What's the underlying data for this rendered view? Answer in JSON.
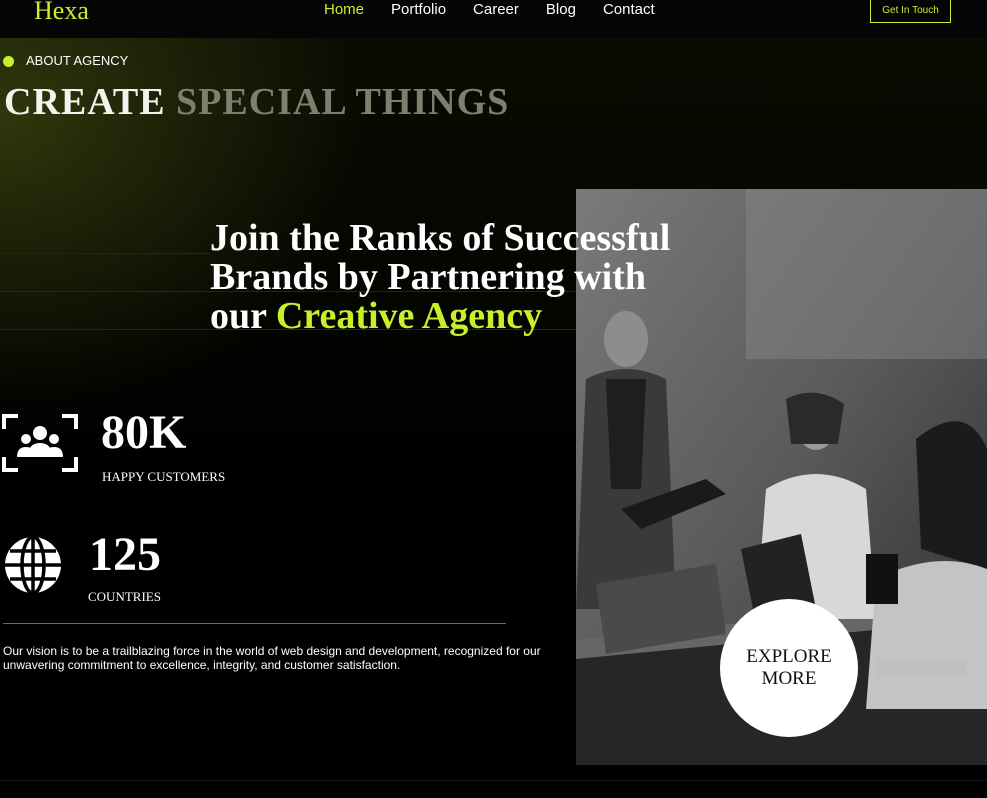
{
  "header": {
    "logo": "Hexa",
    "nav": [
      {
        "label": "Home",
        "active": true
      },
      {
        "label": "Portfolio",
        "active": false
      },
      {
        "label": "Career",
        "active": false
      },
      {
        "label": "Blog",
        "active": false
      },
      {
        "label": "Contact",
        "active": false
      }
    ],
    "cta_label": "Get In Touch"
  },
  "about": {
    "label": "ABOUT AGENCY",
    "title_part1": "CREATE",
    "title_part2": "SPECIAL THINGS"
  },
  "headline": {
    "line1": "Join the Ranks of Successful",
    "line2": "Brands by Partnering with",
    "line3_prefix": "our",
    "line3_accent": "Creative Agency"
  },
  "stats": [
    {
      "icon": "users-scan-icon",
      "value": "80K",
      "label": "HAPPY CUSTOMERS"
    },
    {
      "icon": "globe-icon",
      "value": "125",
      "label": "COUNTRIES"
    }
  ],
  "vision_text": "Our vision is to be a trailblazing force in the world of web design and development, recognized for our unwavering commitment to excellence, integrity, and customer satisfaction.",
  "explore": {
    "line1": "EXPLORE",
    "line2": "MORE"
  },
  "colors": {
    "accent": "#c8f02a",
    "background": "#000000",
    "muted_title": "#7c806f"
  }
}
